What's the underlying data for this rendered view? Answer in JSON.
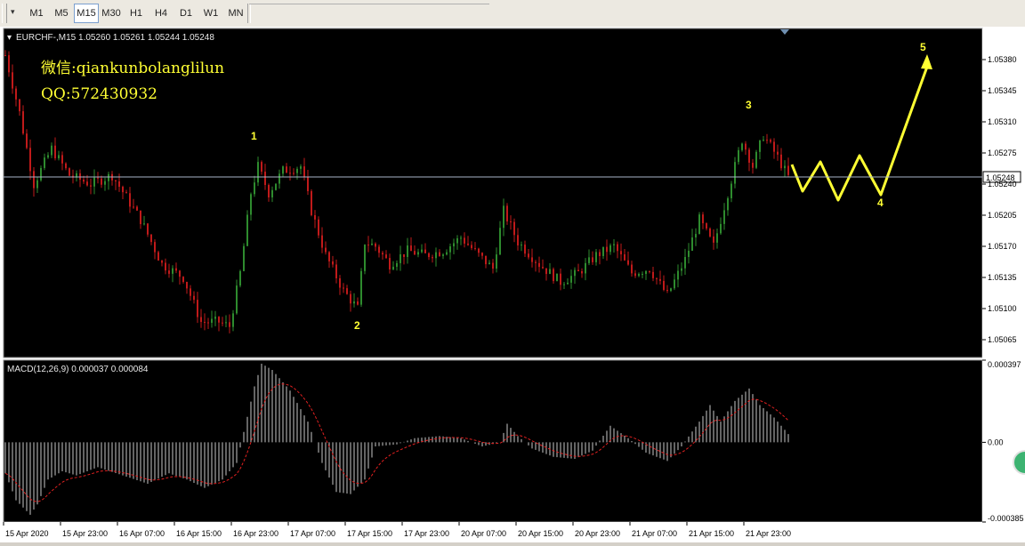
{
  "toolbar": {
    "dropdown_icon": "chevron-down-icon",
    "timeframes": [
      {
        "label": "M1",
        "active": false
      },
      {
        "label": "M5",
        "active": false
      },
      {
        "label": "M15",
        "active": true
      },
      {
        "label": "M30",
        "active": false
      },
      {
        "label": "H1",
        "active": false
      },
      {
        "label": "H4",
        "active": false
      },
      {
        "label": "D1",
        "active": false
      },
      {
        "label": "W1",
        "active": false
      },
      {
        "label": "MN",
        "active": false
      }
    ]
  },
  "watermark": {
    "wechat": "微信:qiankunbolanglilun",
    "qq": "QQ:572430932"
  },
  "colors": {
    "background": "#000000",
    "bull": "#2e8b2e",
    "bear": "#c01a1a",
    "annotation": "#ffff33",
    "price_line": "#a8b4c8",
    "macd_hist": "#c8c8c8",
    "macd_signal": "#e02020"
  },
  "chart_data": [
    {
      "type": "candlestick",
      "title": "EURCHF-,M15  1.05260 1.05261 1.05244 1.05248",
      "symbol": "EURCHF-",
      "timeframe": "M15",
      "ohlc_readout": {
        "open": 1.0526,
        "high": 1.05261,
        "low": 1.05244,
        "close": 1.05248
      },
      "current_price": 1.05248,
      "current_price_label": "1.05248",
      "ylim": [
        1.05045,
        1.05415
      ],
      "y_ticks": [
        "1.05380",
        "1.05345",
        "1.05310",
        "1.05275",
        "1.05240",
        "1.05205",
        "1.05170",
        "1.05135",
        "1.05100",
        "1.05065"
      ],
      "x_ticks": [
        "15 Apr 2020",
        "15 Apr 23:00",
        "16 Apr 07:00",
        "16 Apr 15:00",
        "16 Apr 23:00",
        "17 Apr 07:00",
        "17 Apr 15:00",
        "17 Apr 23:00",
        "20 Apr 07:00",
        "20 Apr 15:00",
        "20 Apr 23:00",
        "21 Apr 07:00",
        "21 Apr 15:00",
        "21 Apr 23:00"
      ],
      "close_path": [
        {
          "t": 0,
          "p": 1.05385
        },
        {
          "t": 4,
          "p": 1.0532
        },
        {
          "t": 8,
          "p": 1.0524
        },
        {
          "t": 13,
          "p": 1.0528
        },
        {
          "t": 18,
          "p": 1.0525
        },
        {
          "t": 24,
          "p": 1.0524
        },
        {
          "t": 30,
          "p": 1.0525
        },
        {
          "t": 38,
          "p": 1.052
        },
        {
          "t": 44,
          "p": 1.0515
        },
        {
          "t": 50,
          "p": 1.05135
        },
        {
          "t": 55,
          "p": 1.05085
        },
        {
          "t": 60,
          "p": 1.05085
        },
        {
          "t": 63,
          "p": 1.0508
        },
        {
          "t": 66,
          "p": 1.0514
        },
        {
          "t": 69,
          "p": 1.0523
        },
        {
          "t": 71,
          "p": 1.0526
        },
        {
          "t": 74,
          "p": 1.0523
        },
        {
          "t": 78,
          "p": 1.05255
        },
        {
          "t": 83,
          "p": 1.0526
        },
        {
          "t": 86,
          "p": 1.0521
        },
        {
          "t": 90,
          "p": 1.0516
        },
        {
          "t": 95,
          "p": 1.0512
        },
        {
          "t": 99,
          "p": 1.051
        },
        {
          "t": 101,
          "p": 1.05175
        },
        {
          "t": 104,
          "p": 1.0517
        },
        {
          "t": 108,
          "p": 1.0515
        },
        {
          "t": 113,
          "p": 1.05165
        },
        {
          "t": 118,
          "p": 1.0516
        },
        {
          "t": 123,
          "p": 1.05165
        },
        {
          "t": 128,
          "p": 1.0518
        },
        {
          "t": 133,
          "p": 1.0516
        },
        {
          "t": 137,
          "p": 1.05145
        },
        {
          "t": 140,
          "p": 1.0521
        },
        {
          "t": 144,
          "p": 1.05175
        },
        {
          "t": 150,
          "p": 1.0515
        },
        {
          "t": 156,
          "p": 1.0513
        },
        {
          "t": 161,
          "p": 1.0514
        },
        {
          "t": 166,
          "p": 1.0516
        },
        {
          "t": 171,
          "p": 1.0517
        },
        {
          "t": 176,
          "p": 1.0514
        },
        {
          "t": 181,
          "p": 1.05145
        },
        {
          "t": 186,
          "p": 1.05115
        },
        {
          "t": 191,
          "p": 1.05155
        },
        {
          "t": 195,
          "p": 1.052
        },
        {
          "t": 199,
          "p": 1.0517
        },
        {
          "t": 203,
          "p": 1.0523
        },
        {
          "t": 207,
          "p": 1.0529
        },
        {
          "t": 210,
          "p": 1.0526
        },
        {
          "t": 213,
          "p": 1.05295
        },
        {
          "t": 217,
          "p": 1.0527
        },
        {
          "t": 220,
          "p": 1.05248
        }
      ],
      "wave_labels": [
        {
          "label": "1",
          "t": 70,
          "p": 1.0529
        },
        {
          "label": "2",
          "t": 99,
          "p": 1.05077
        },
        {
          "label": "3",
          "t": 209,
          "p": 1.05325
        },
        {
          "label": "4",
          "t": 246,
          "p": 1.05215
        },
        {
          "label": "5",
          "t": 258,
          "p": 1.0539
        }
      ],
      "projection": [
        {
          "t": 221,
          "p": 1.05262
        },
        {
          "t": 224,
          "p": 1.05232
        },
        {
          "t": 229,
          "p": 1.05265
        },
        {
          "t": 234,
          "p": 1.05222
        },
        {
          "t": 240,
          "p": 1.05272
        },
        {
          "t": 246,
          "p": 1.05228
        },
        {
          "t": 259,
          "p": 1.05372
        }
      ]
    },
    {
      "type": "histogram",
      "title": "MACD(12,26,9) 0.000037 0.000084",
      "indicator": "MACD(12,26,9)",
      "macd": 3.7e-05,
      "signal": 8.4e-05,
      "ylim": [
        -0.000385,
        0.000397
      ],
      "y_ticks": [
        "0.000397",
        "0.00",
        "-0.000385"
      ],
      "macd_path": [
        {
          "t": 0,
          "v": -0.00015
        },
        {
          "t": 3,
          "v": -0.00028
        },
        {
          "t": 7,
          "v": -0.00035
        },
        {
          "t": 9,
          "v": -0.0003
        },
        {
          "t": 12,
          "v": -0.00018
        },
        {
          "t": 16,
          "v": -0.00014
        },
        {
          "t": 20,
          "v": -0.00016
        },
        {
          "t": 26,
          "v": -0.00012
        },
        {
          "t": 33,
          "v": -0.00016
        },
        {
          "t": 40,
          "v": -0.0002
        },
        {
          "t": 46,
          "v": -0.00015
        },
        {
          "t": 51,
          "v": -0.00018
        },
        {
          "t": 56,
          "v": -0.00022
        },
        {
          "t": 61,
          "v": -0.00018
        },
        {
          "t": 65,
          "v": -0.0001
        },
        {
          "t": 67,
          "v": 5e-05
        },
        {
          "t": 70,
          "v": 0.00027
        },
        {
          "t": 72,
          "v": 0.00038
        },
        {
          "t": 75,
          "v": 0.00035
        },
        {
          "t": 80,
          "v": 0.00025
        },
        {
          "t": 85,
          "v": 0.0001
        },
        {
          "t": 89,
          "v": -0.0001
        },
        {
          "t": 93,
          "v": -0.00024
        },
        {
          "t": 97,
          "v": -0.00025
        },
        {
          "t": 101,
          "v": -0.00018
        },
        {
          "t": 104,
          "v": -2e-05
        },
        {
          "t": 110,
          "v": -1e-05
        },
        {
          "t": 115,
          "v": 2e-05
        },
        {
          "t": 122,
          "v": 3e-05
        },
        {
          "t": 128,
          "v": 2e-05
        },
        {
          "t": 134,
          "v": -2e-05
        },
        {
          "t": 139,
          "v": 0.0
        },
        {
          "t": 141,
          "v": 9e-05
        },
        {
          "t": 144,
          "v": 3e-05
        },
        {
          "t": 148,
          "v": -3e-05
        },
        {
          "t": 154,
          "v": -7e-05
        },
        {
          "t": 160,
          "v": -8e-05
        },
        {
          "t": 165,
          "v": -4e-05
        },
        {
          "t": 170,
          "v": 8e-05
        },
        {
          "t": 175,
          "v": 2e-05
        },
        {
          "t": 180,
          "v": -5e-05
        },
        {
          "t": 186,
          "v": -9e-05
        },
        {
          "t": 190,
          "v": -2e-05
        },
        {
          "t": 195,
          "v": 0.0001
        },
        {
          "t": 198,
          "v": 0.00018
        },
        {
          "t": 201,
          "v": 0.0001
        },
        {
          "t": 205,
          "v": 0.0002
        },
        {
          "t": 209,
          "v": 0.00026
        },
        {
          "t": 212,
          "v": 0.00018
        },
        {
          "t": 216,
          "v": 0.00012
        },
        {
          "t": 220,
          "v": 4e-05
        }
      ]
    }
  ]
}
